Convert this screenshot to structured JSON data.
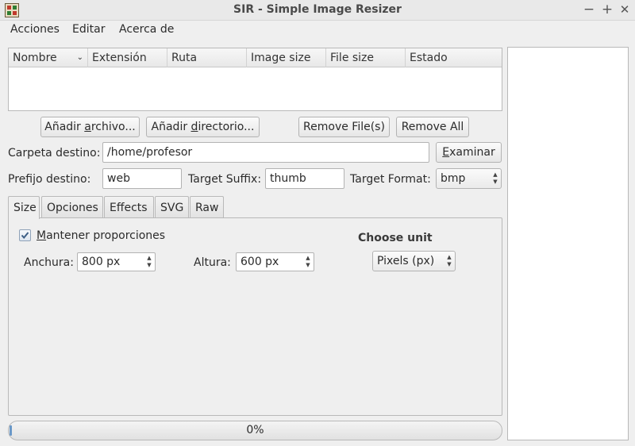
{
  "window": {
    "title": "SIR - Simple Image Resizer",
    "controls": {
      "minimize": "−",
      "maximize": "+",
      "close": "✕"
    }
  },
  "menu": {
    "items": [
      "Acciones",
      "Editar",
      "Acerca de"
    ]
  },
  "table": {
    "columns": [
      "Nombre",
      "Extensión",
      "Ruta",
      "Image size",
      "File size",
      "Estado"
    ],
    "rows": []
  },
  "buttons": {
    "add_file": "Añadir archivo...",
    "add_dir": "Añadir directorio...",
    "remove_files": "Remove File(s)",
    "remove_all": "Remove All",
    "browse": "Examinar"
  },
  "destination": {
    "label": "Carpeta destino:",
    "value": "/home/profesor"
  },
  "prefix": {
    "label": "Prefijo destino:",
    "value": "web"
  },
  "suffix": {
    "label": "Target Suffix:",
    "value": "thumb"
  },
  "format": {
    "label": "Target Format:",
    "value": "bmp"
  },
  "tabs": [
    "Size",
    "Opciones",
    "Effects",
    "SVG",
    "Raw"
  ],
  "size_tab": {
    "keep_ratio_label": "Mantener proporciones",
    "keep_ratio_checked": true,
    "width_label": "Anchura:",
    "width_value": "800 px",
    "height_label": "Altura:",
    "height_value": "600 px",
    "unit_heading": "Choose unit",
    "unit_value": "Pixels (px)"
  },
  "progress": {
    "text": "0%",
    "value": 0
  },
  "colors": {
    "progress_fill": "#6a98c8",
    "background": "#efefef"
  }
}
